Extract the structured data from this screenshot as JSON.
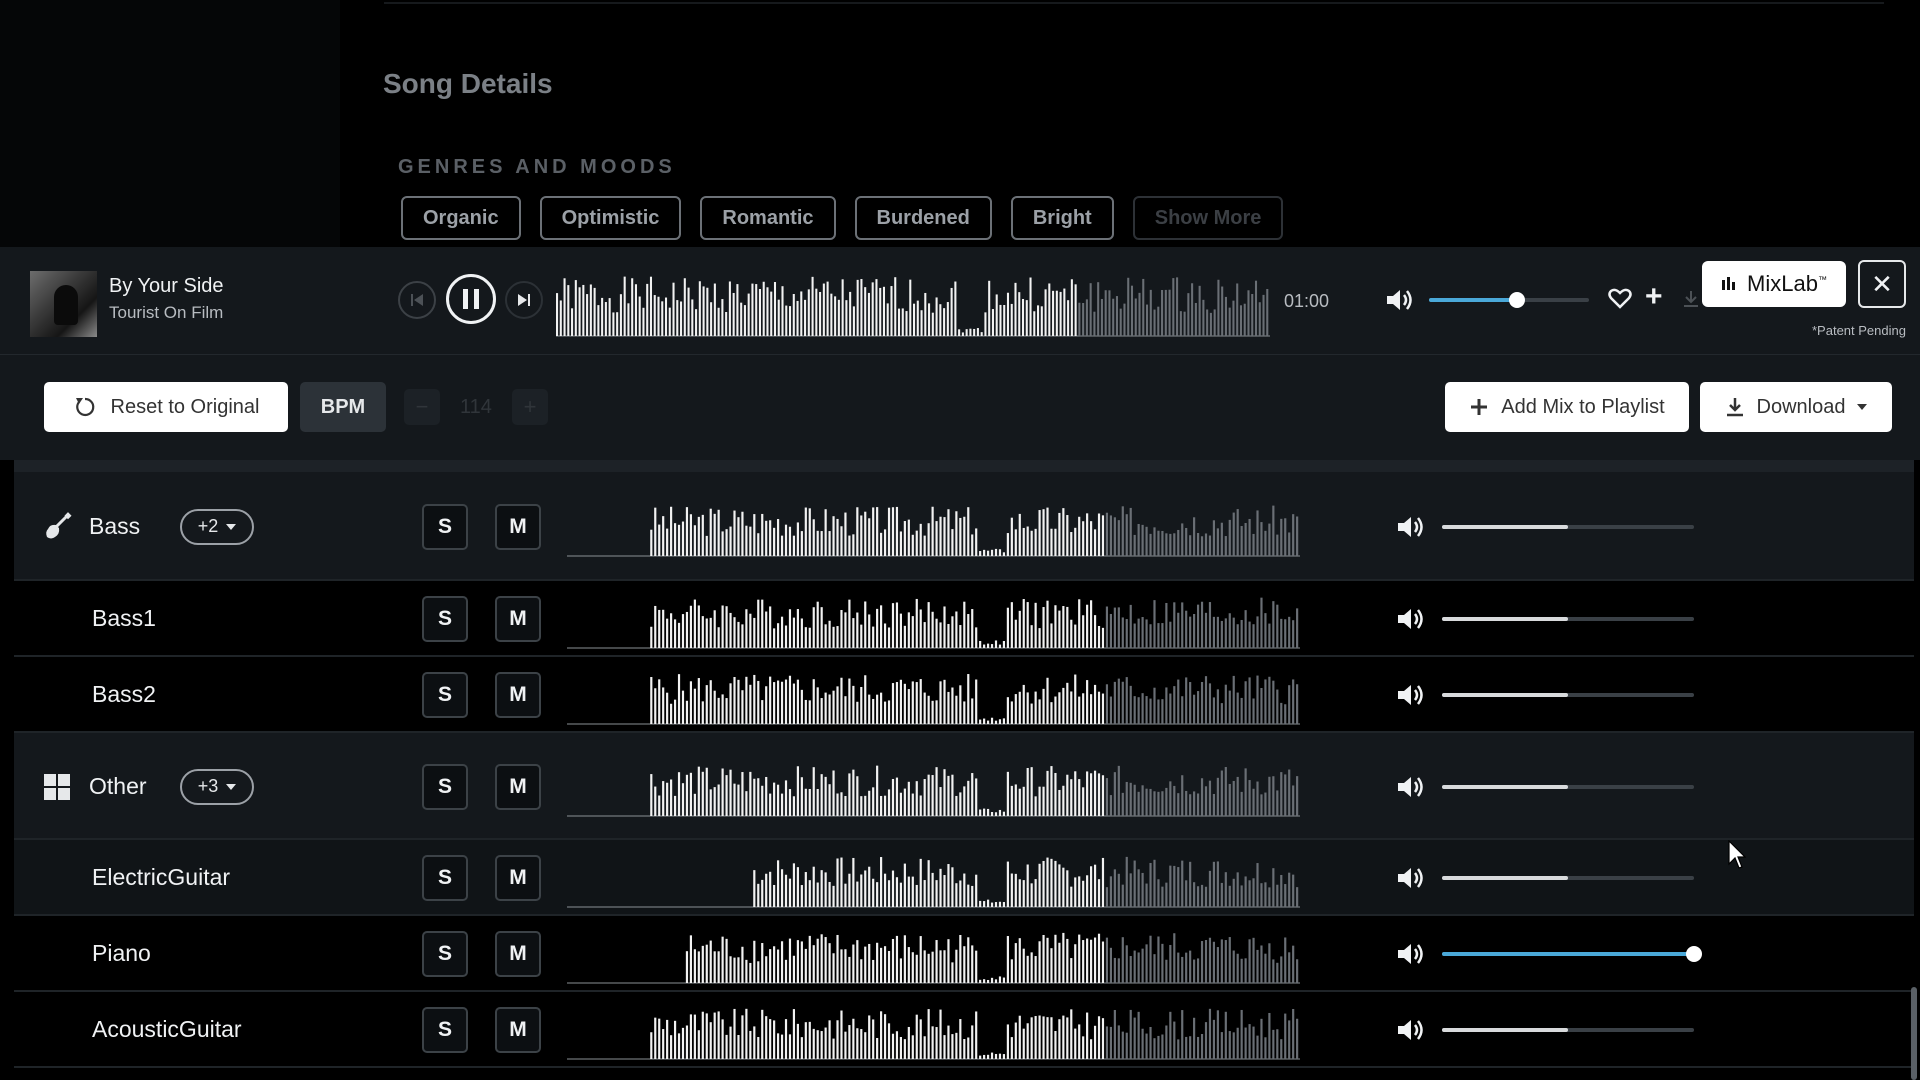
{
  "page": {
    "section_title": "Song Details",
    "genres_heading": "GENRES AND MOODS",
    "chips": [
      "Organic",
      "Optimistic",
      "Romantic",
      "Burdened",
      "Bright"
    ],
    "show_more": "Show More"
  },
  "player": {
    "title": "By Your Side",
    "artist": "Tourist On Film",
    "time": "01:00",
    "volume": 0.55,
    "mixlab_label": "MixLab",
    "mixlab_tm": "™",
    "patent": "*Patent Pending",
    "close_glyph": "✕",
    "progress": 0.73
  },
  "toolbar": {
    "reset_label": "Reset to Original",
    "bpm_label": "BPM",
    "bpm_value": "114",
    "bpm_minus": "−",
    "bpm_plus": "+",
    "add_mix_label": "Add Mix to Playlist",
    "download_label": "Download"
  },
  "tracks": [
    {
      "name": "Bass",
      "kind": "group",
      "badge": "+2",
      "icon": "guitar-icon",
      "volume": 0.5,
      "s": "S",
      "m": "M"
    },
    {
      "name": "Bass1",
      "kind": "sub",
      "volume": 0.5,
      "s": "S",
      "m": "M"
    },
    {
      "name": "Bass2",
      "kind": "sub",
      "volume": 0.5,
      "s": "S",
      "m": "M"
    },
    {
      "name": "Other",
      "kind": "group",
      "badge": "+3",
      "icon": "grid-icon",
      "volume": 0.5,
      "s": "S",
      "m": "M"
    },
    {
      "name": "ElectricGuitar",
      "kind": "sub",
      "volume": 0.5,
      "s": "S",
      "m": "M"
    },
    {
      "name": "Piano",
      "kind": "sub",
      "volume": 1.0,
      "s": "S",
      "m": "M"
    },
    {
      "name": "AcousticGuitar",
      "kind": "sub",
      "volume": 0.5,
      "s": "S",
      "m": "M"
    }
  ],
  "colors": {
    "accent": "#4aa8d8",
    "played_wave": "#f2f2f2",
    "unplayed_wave": "#6a6f75",
    "slider_track": "#3a4046",
    "slider_fill_default": "#d8dadc"
  }
}
